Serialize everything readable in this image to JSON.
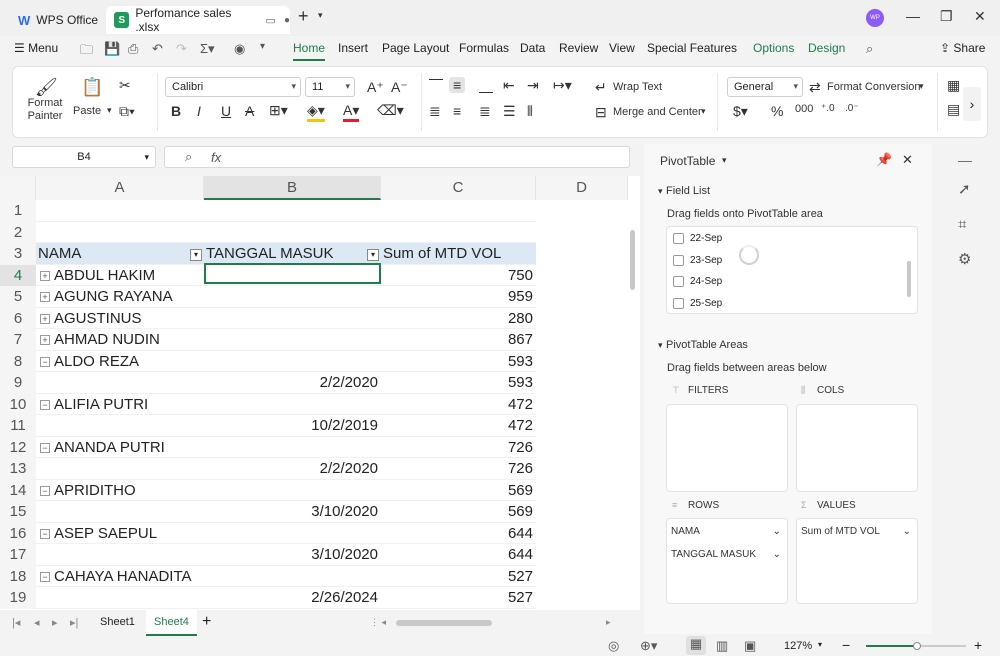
{
  "titlebar": {
    "app_tab": "WPS Office",
    "file_tab": "Perfomance sales .xlsx",
    "avatar_initials": "WP"
  },
  "menubar": {
    "menu_label": "Menu",
    "items": [
      "Home",
      "Insert",
      "Page Layout",
      "Formulas",
      "Data",
      "Review",
      "View",
      "Special Features",
      "Options",
      "Design"
    ],
    "share_label": "Share",
    "accent_color": "#1e7e4a"
  },
  "ribbon": {
    "format_painter": "Format Painter",
    "paste": "Paste",
    "font_name": "Calibri",
    "font_size": "11",
    "wrap_text": "Wrap Text",
    "merge_center": "Merge and Center",
    "number_format": "General",
    "format_conversion": "Format Conversion"
  },
  "formula": {
    "name_box": "B4",
    "fx_label": "fx",
    "value": ""
  },
  "sheet": {
    "columns": [
      "A",
      "B",
      "C",
      "D"
    ],
    "headers": {
      "a": "NAMA",
      "b": "TANGGAL MASUK",
      "c": "Sum of MTD VOL"
    },
    "rows": [
      {
        "num": "1",
        "a": "",
        "b": "",
        "c": "",
        "pm": ""
      },
      {
        "num": "2",
        "a": "",
        "b": "",
        "c": "",
        "pm": ""
      },
      {
        "num": "3",
        "a": "NAMA",
        "b": "TANGGAL MASUK",
        "c": "Sum of MTD VOL",
        "pm": "hdr"
      },
      {
        "num": "4",
        "a": "ABDUL HAKIM",
        "b": "",
        "c": "750",
        "pm": "+"
      },
      {
        "num": "5",
        "a": "AGUNG RAYANA",
        "b": "",
        "c": "959",
        "pm": "+"
      },
      {
        "num": "6",
        "a": "AGUSTINUS",
        "b": "",
        "c": "280",
        "pm": "+"
      },
      {
        "num": "7",
        "a": "AHMAD NUDIN",
        "b": "",
        "c": "867",
        "pm": "+"
      },
      {
        "num": "8",
        "a": "ALDO REZA",
        "b": "",
        "c": "593",
        "pm": "-"
      },
      {
        "num": "9",
        "a": "",
        "b": "2/2/2020",
        "c": "593",
        "pm": ""
      },
      {
        "num": "10",
        "a": "ALIFIA PUTRI",
        "b": "",
        "c": "472",
        "pm": "-"
      },
      {
        "num": "11",
        "a": "",
        "b": "10/2/2019",
        "c": "472",
        "pm": ""
      },
      {
        "num": "12",
        "a": "ANANDA PUTRI",
        "b": "",
        "c": "726",
        "pm": "-"
      },
      {
        "num": "13",
        "a": "",
        "b": "2/2/2020",
        "c": "726",
        "pm": ""
      },
      {
        "num": "14",
        "a": "APRIDITHO",
        "b": "",
        "c": "569",
        "pm": "-"
      },
      {
        "num": "15",
        "a": "",
        "b": "3/10/2020",
        "c": "569",
        "pm": ""
      },
      {
        "num": "16",
        "a": "ASEP SAEPUL",
        "b": "",
        "c": "644",
        "pm": "-"
      },
      {
        "num": "17",
        "a": "",
        "b": "3/10/2020",
        "c": "644",
        "pm": ""
      },
      {
        "num": "18",
        "a": "CAHAYA HANADITA",
        "b": "",
        "c": "527",
        "pm": "-"
      },
      {
        "num": "19",
        "a": "",
        "b": "2/26/2024",
        "c": "527",
        "pm": ""
      }
    ],
    "sheet_tabs": [
      "Sheet1",
      "Sheet4"
    ],
    "active_sheet": "Sheet4"
  },
  "pivot": {
    "title": "PivotTable",
    "field_list_label": "Field List",
    "field_list_hint": "Drag fields onto PivotTable area",
    "fields": [
      "22-Sep",
      "23-Sep",
      "24-Sep",
      "25-Sep"
    ],
    "areas_label": "PivotTable Areas",
    "areas_hint": "Drag fields between areas below",
    "filters_label": "FILTERS",
    "cols_label": "COLS",
    "rows_label": "ROWS",
    "values_label": "VALUES",
    "rows_fields": [
      "NAMA",
      "TANGGAL MASUK"
    ],
    "values_fields": [
      "Sum of MTD VOL"
    ]
  },
  "status": {
    "zoom": "127%"
  }
}
